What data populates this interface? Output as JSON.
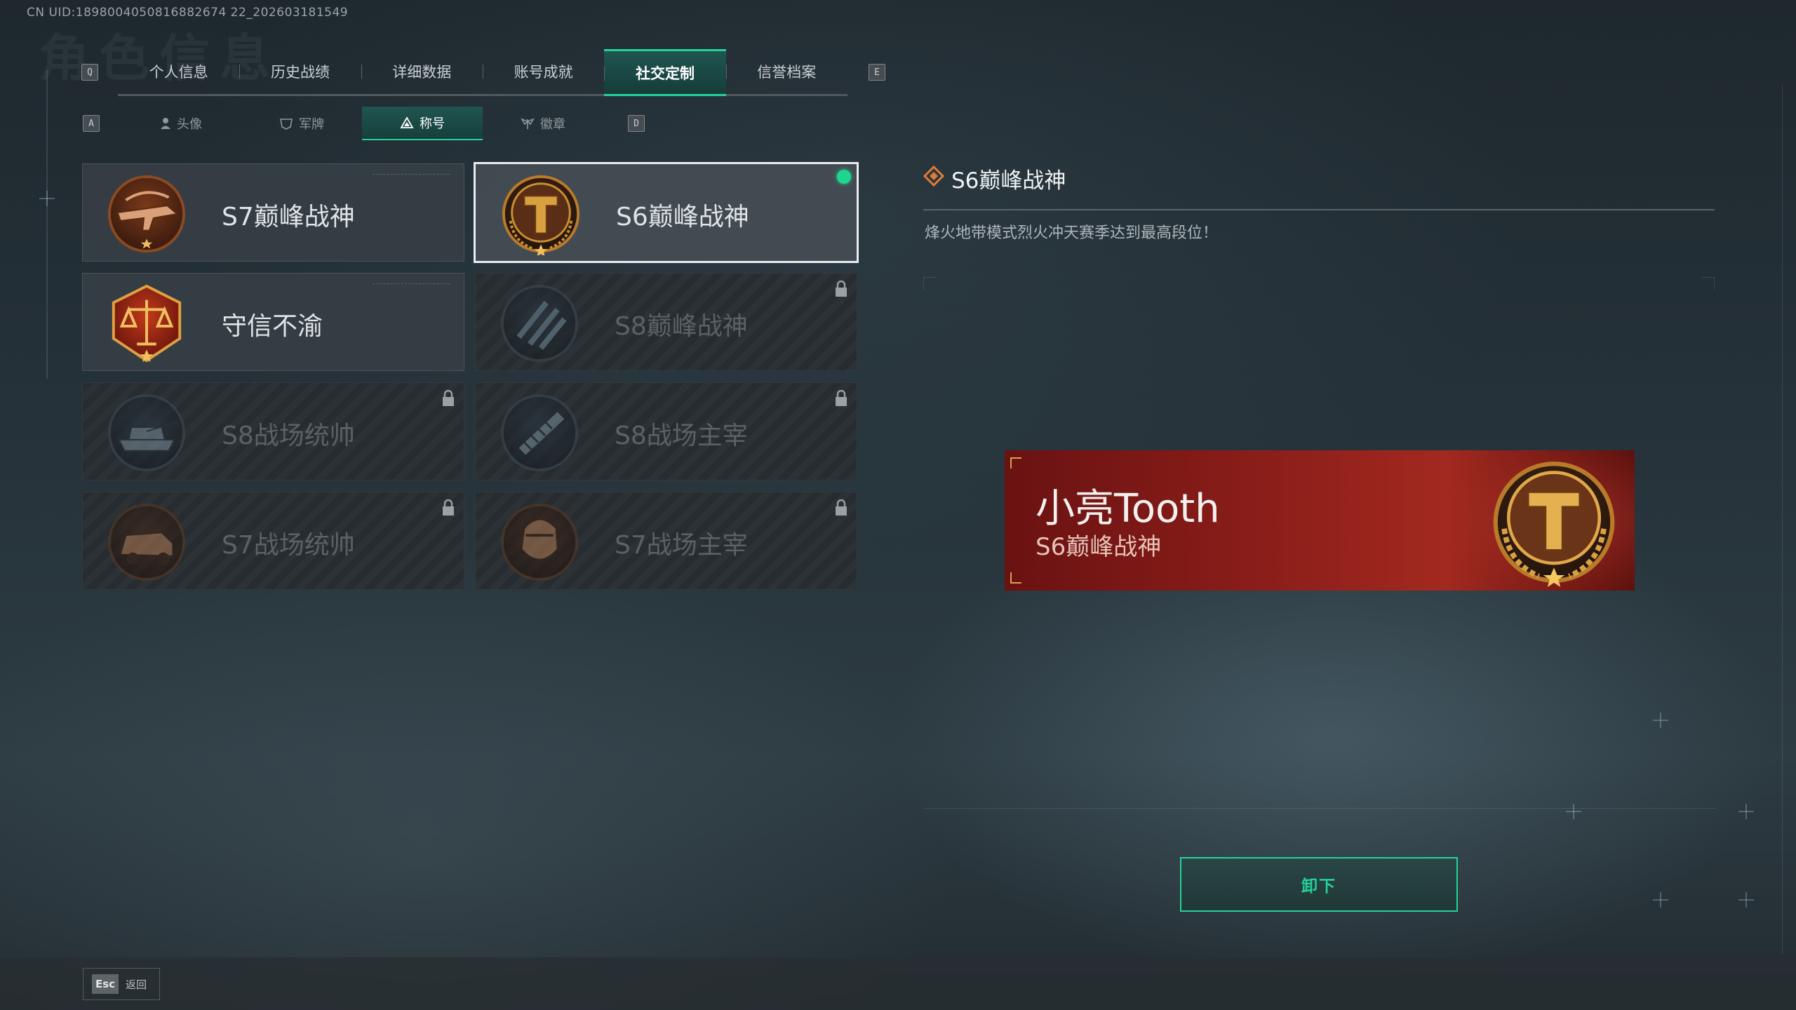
{
  "uid_text": "CN UID:1898004050816882674 22_202603181549",
  "ghost_title": "角色信息",
  "main_tabs": {
    "prev_key": "Q",
    "next_key": "E",
    "items": [
      {
        "label": "个人信息",
        "active": false
      },
      {
        "label": "历史战绩",
        "active": false
      },
      {
        "label": "详细数据",
        "active": false
      },
      {
        "label": "账号成就",
        "active": false
      },
      {
        "label": "社交定制",
        "active": true
      },
      {
        "label": "信誉档案",
        "active": false
      }
    ]
  },
  "sub_tabs": {
    "prev_key": "A",
    "next_key": "D",
    "items": [
      {
        "label": "头像",
        "icon": "person-icon",
        "active": false
      },
      {
        "label": "军牌",
        "icon": "dog-tag-icon",
        "active": false
      },
      {
        "label": "称号",
        "icon": "triangle-title-icon",
        "active": true
      },
      {
        "label": "徽章",
        "icon": "wings-badge-icon",
        "active": false
      }
    ]
  },
  "titles": [
    {
      "label": "S7巅峰战神",
      "emblem": "rifle-emblem-icon",
      "locked": false,
      "selected": false,
      "equipped": false
    },
    {
      "label": "S6巅峰战神",
      "emblem": "t-shield-emblem-icon",
      "locked": false,
      "selected": true,
      "equipped": true
    },
    {
      "label": "守信不渝",
      "emblem": "scales-emblem-icon",
      "locked": false,
      "selected": false,
      "equipped": false
    },
    {
      "label": "S8巅峰战神",
      "emblem": "slash-emblem-icon",
      "locked": true,
      "selected": false,
      "equipped": false
    },
    {
      "label": "S8战场统帅",
      "emblem": "tank-emblem-icon",
      "locked": true,
      "selected": false,
      "equipped": false
    },
    {
      "label": "S8战场主宰",
      "emblem": "missile-emblem-icon",
      "locked": true,
      "selected": false,
      "equipped": false
    },
    {
      "label": "S7战场统帅",
      "emblem": "vehicle-emblem-icon",
      "locked": true,
      "selected": false,
      "equipped": false
    },
    {
      "label": "S7战场主宰",
      "emblem": "soldier-emblem-icon",
      "locked": true,
      "selected": false,
      "equipped": false
    }
  ],
  "detail": {
    "title": "S6巅峰战神",
    "description": "烽火地带模式烈火冲天赛季达到最高段位！",
    "icon": "diamond-marker-icon"
  },
  "banner": {
    "player_name": "小亮Tooth",
    "title": "S6巅峰战神",
    "emblem": "t-shield-emblem-icon"
  },
  "action": {
    "unequip_label": "卸下"
  },
  "footer": {
    "esc_key": "Esc",
    "esc_label": "返回"
  },
  "colors": {
    "accent": "#25d29a",
    "banner_red": "#8e1f1a",
    "gold": "#c8902e"
  }
}
